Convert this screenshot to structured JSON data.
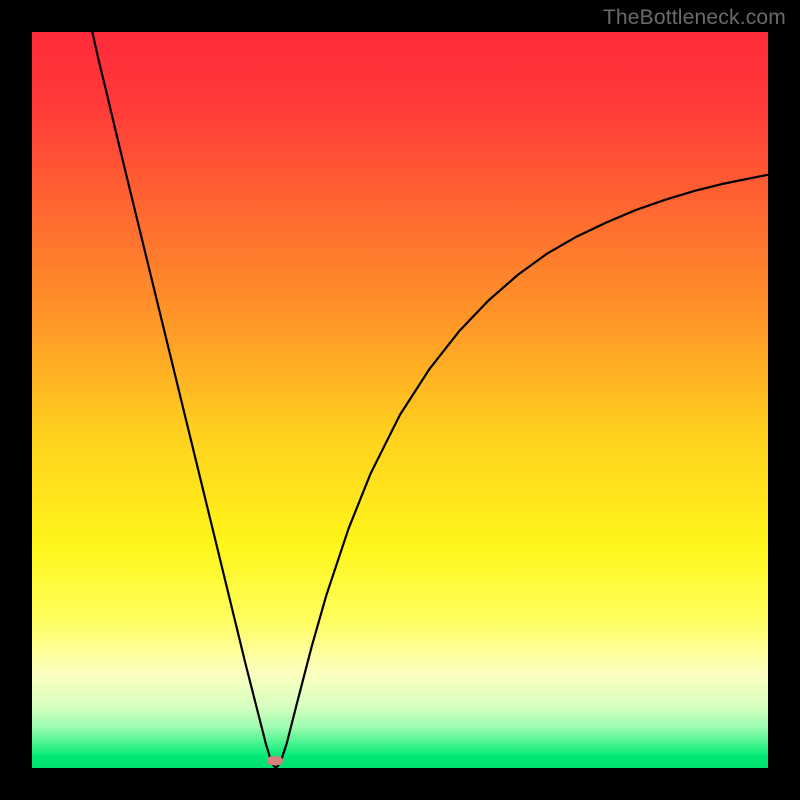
{
  "watermark": "TheBottleneck.com",
  "chart_data": {
    "type": "line",
    "title": "",
    "xlabel": "",
    "ylabel": "",
    "xlim": [
      0,
      100
    ],
    "ylim": [
      0,
      100
    ],
    "gradient_stops": [
      {
        "offset": 0.0,
        "color": "#ff2a3a"
      },
      {
        "offset": 0.1,
        "color": "#ff3a39"
      },
      {
        "offset": 0.25,
        "color": "#ff6a30"
      },
      {
        "offset": 0.4,
        "color": "#ff9a28"
      },
      {
        "offset": 0.55,
        "color": "#ffd21e"
      },
      {
        "offset": 0.7,
        "color": "#fff61a"
      },
      {
        "offset": 0.8,
        "color": "#ffff60"
      },
      {
        "offset": 0.87,
        "color": "#fdffc0"
      },
      {
        "offset": 0.915,
        "color": "#d8ffc0"
      },
      {
        "offset": 0.945,
        "color": "#9cfcb0"
      },
      {
        "offset": 0.965,
        "color": "#4cf590"
      },
      {
        "offset": 0.985,
        "color": "#00e874"
      },
      {
        "offset": 1.0,
        "color": "#00e070"
      }
    ],
    "curve": {
      "color": "#000000",
      "width": 2.2,
      "points": [
        {
          "x": 8.2,
          "y": 100.0
        },
        {
          "x": 9.0,
          "y": 96.4
        },
        {
          "x": 10.0,
          "y": 92.3
        },
        {
          "x": 11.5,
          "y": 86.0
        },
        {
          "x": 13.0,
          "y": 79.8
        },
        {
          "x": 15.0,
          "y": 71.6
        },
        {
          "x": 17.0,
          "y": 63.4
        },
        {
          "x": 19.0,
          "y": 55.2
        },
        {
          "x": 21.0,
          "y": 47.0
        },
        {
          "x": 23.0,
          "y": 38.8
        },
        {
          "x": 25.0,
          "y": 30.6
        },
        {
          "x": 27.0,
          "y": 22.4
        },
        {
          "x": 29.0,
          "y": 14.2
        },
        {
          "x": 30.5,
          "y": 8.3
        },
        {
          "x": 31.8,
          "y": 3.2
        },
        {
          "x": 32.6,
          "y": 0.6
        },
        {
          "x": 33.1,
          "y": 0.0
        },
        {
          "x": 33.7,
          "y": 0.6
        },
        {
          "x": 34.6,
          "y": 3.3
        },
        {
          "x": 36.0,
          "y": 8.8
        },
        {
          "x": 38.0,
          "y": 16.5
        },
        {
          "x": 40.0,
          "y": 23.5
        },
        {
          "x": 43.0,
          "y": 32.5
        },
        {
          "x": 46.0,
          "y": 40.0
        },
        {
          "x": 50.0,
          "y": 48.0
        },
        {
          "x": 54.0,
          "y": 54.2
        },
        {
          "x": 58.0,
          "y": 59.3
        },
        {
          "x": 62.0,
          "y": 63.5
        },
        {
          "x": 66.0,
          "y": 67.0
        },
        {
          "x": 70.0,
          "y": 69.9
        },
        {
          "x": 74.0,
          "y": 72.2
        },
        {
          "x": 78.0,
          "y": 74.1
        },
        {
          "x": 82.0,
          "y": 75.8
        },
        {
          "x": 86.0,
          "y": 77.2
        },
        {
          "x": 90.0,
          "y": 78.4
        },
        {
          "x": 94.0,
          "y": 79.4
        },
        {
          "x": 98.0,
          "y": 80.2
        },
        {
          "x": 100.0,
          "y": 80.6
        }
      ]
    },
    "marker": {
      "x": 33.0,
      "y": 1.0,
      "width_pct": 2.2,
      "height_pct": 1.3,
      "color": "#d88080"
    }
  }
}
